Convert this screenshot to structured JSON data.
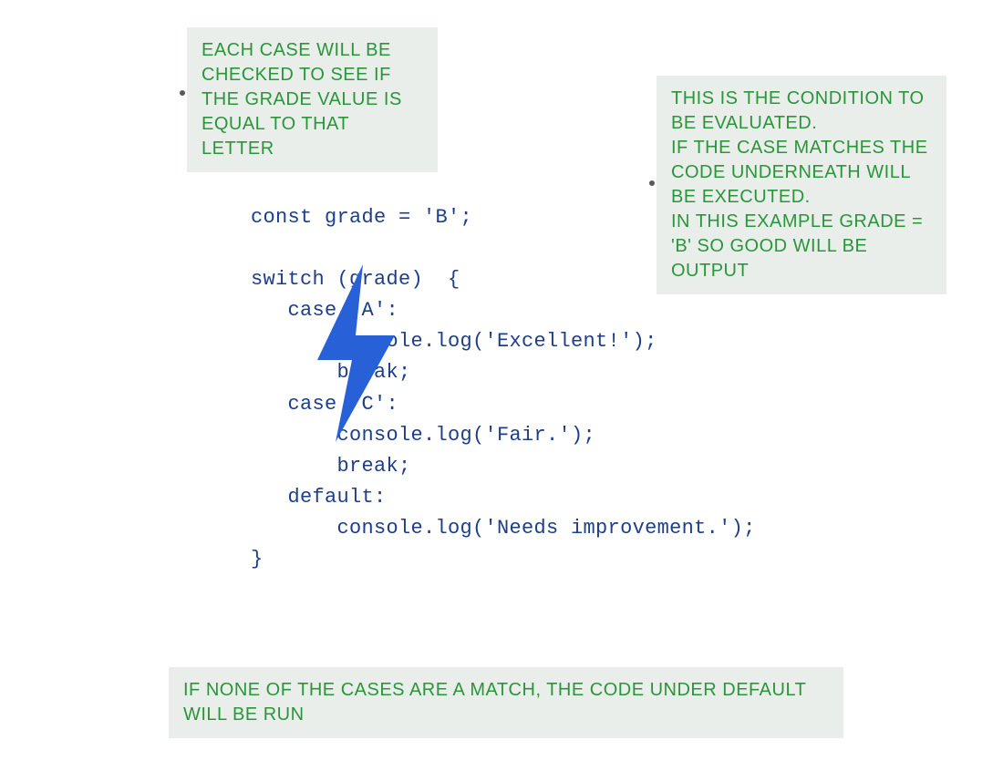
{
  "annotations": {
    "top_left": "EACH CASE WILL BE CHECKED TO SEE IF THE GRADE VALUE IS EQUAL TO THAT LETTER",
    "top_right": "THIS IS THE CONDITION TO BE EVALUATED.\nIF THE CASE MATCHES THE CODE UNDERNEATH WILL BE EXECUTED.\nIN THIS EXAMPLE GRADE = 'B' SO GOOD WILL BE OUTPUT",
    "bottom": "IF NONE OF THE CASES ARE A MATCH, THE CODE UNDER DEFAULT WILL BE RUN"
  },
  "code": {
    "line1": "const grade = 'B';",
    "line2": "",
    "line3": "switch (grade)  {",
    "line4": "   case 'A':",
    "line5": "       console.log('Excellent!');",
    "line6": "       break;",
    "line7": "   case 'C':",
    "line8": "       console.log('Fair.');",
    "line9": "       break;",
    "line10": "   default:",
    "line11": "       console.log('Needs improvement.');",
    "line12": "}"
  },
  "colors": {
    "code_text": "#1d3e8a",
    "annotation_bg": "#eaeeeb",
    "annotation_text": "#29963a",
    "lightning": "#2860d8"
  }
}
